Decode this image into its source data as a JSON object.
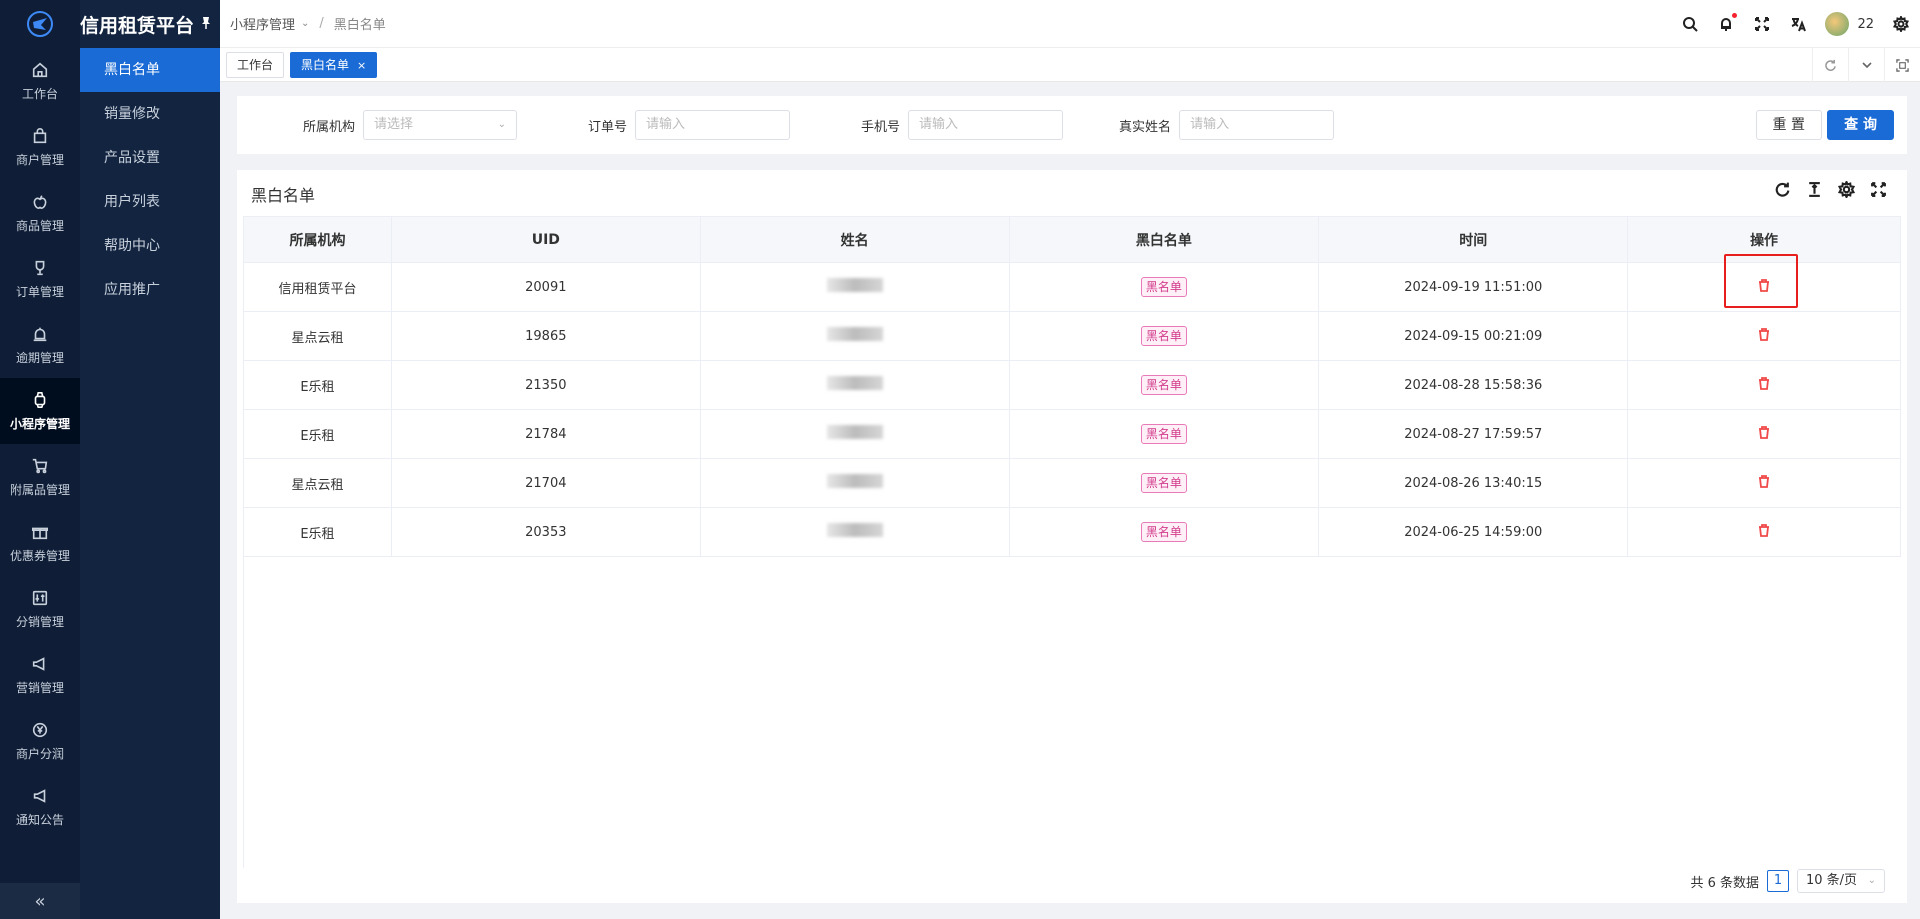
{
  "app": {
    "title": "信用租赁平台"
  },
  "rail": {
    "items": [
      {
        "label": "工作台",
        "icon": "home-icon"
      },
      {
        "label": "商户管理",
        "icon": "shopping-bag-icon"
      },
      {
        "label": "商品管理",
        "icon": "apple-icon"
      },
      {
        "label": "订单管理",
        "icon": "trophy-icon"
      },
      {
        "label": "逾期管理",
        "icon": "alarm-icon"
      },
      {
        "label": "小程序管理",
        "icon": "watch-icon"
      },
      {
        "label": "附属品管理",
        "icon": "cart-icon"
      },
      {
        "label": "优惠券管理",
        "icon": "gift-icon"
      },
      {
        "label": "分销管理",
        "icon": "sliders-icon"
      },
      {
        "label": "营销管理",
        "icon": "megaphone-icon"
      },
      {
        "label": "商户分润",
        "icon": "yen-icon"
      },
      {
        "label": "通知公告",
        "icon": "notice-icon"
      }
    ],
    "collapse": "«"
  },
  "subnav": {
    "items": [
      "黑白名单",
      "销量修改",
      "产品设置",
      "用户列表",
      "帮助中心",
      "应用推广"
    ]
  },
  "breadcrumb": {
    "parent": "小程序管理",
    "current": "黑白名单"
  },
  "header": {
    "username": "22"
  },
  "tabs": {
    "items": [
      "工作台",
      "黑白名单"
    ]
  },
  "filter": {
    "org_label": "所属机构",
    "org_placeholder": "请选择",
    "order_label": "订单号",
    "order_placeholder": "请输入",
    "phone_label": "手机号",
    "phone_placeholder": "请输入",
    "name_label": "真实姓名",
    "name_placeholder": "请输入",
    "reset": "重 置",
    "query": "查 询"
  },
  "table": {
    "title": "黑白名单",
    "columns": [
      "所属机构",
      "UID",
      "姓名",
      "黑白名单",
      "时间",
      "操作"
    ],
    "rows": [
      {
        "org": "信用租赁平台",
        "uid": "20091",
        "list": "黑名单",
        "time": "2024-09-19 11:51:00"
      },
      {
        "org": "星点云租",
        "uid": "19865",
        "list": "黑名单",
        "time": "2024-09-15 00:21:09"
      },
      {
        "org": "E乐租",
        "uid": "21350",
        "list": "黑名单",
        "time": "2024-08-28 15:58:36"
      },
      {
        "org": "E乐租",
        "uid": "21784",
        "list": "黑名单",
        "time": "2024-08-27 17:59:57"
      },
      {
        "org": "星点云租",
        "uid": "21704",
        "list": "黑名单",
        "time": "2024-08-26 13:40:15"
      },
      {
        "org": "E乐租",
        "uid": "20353",
        "list": "黑名单",
        "time": "2024-06-25 14:59:00"
      }
    ]
  },
  "pager": {
    "total": "共 6 条数据",
    "page": "1",
    "size": "10 条/页"
  },
  "colors": {
    "accent": "#1a6bd6",
    "rail_bg": "#0f1e36",
    "danger": "#f04a4a",
    "tag": "#d23c8c"
  }
}
